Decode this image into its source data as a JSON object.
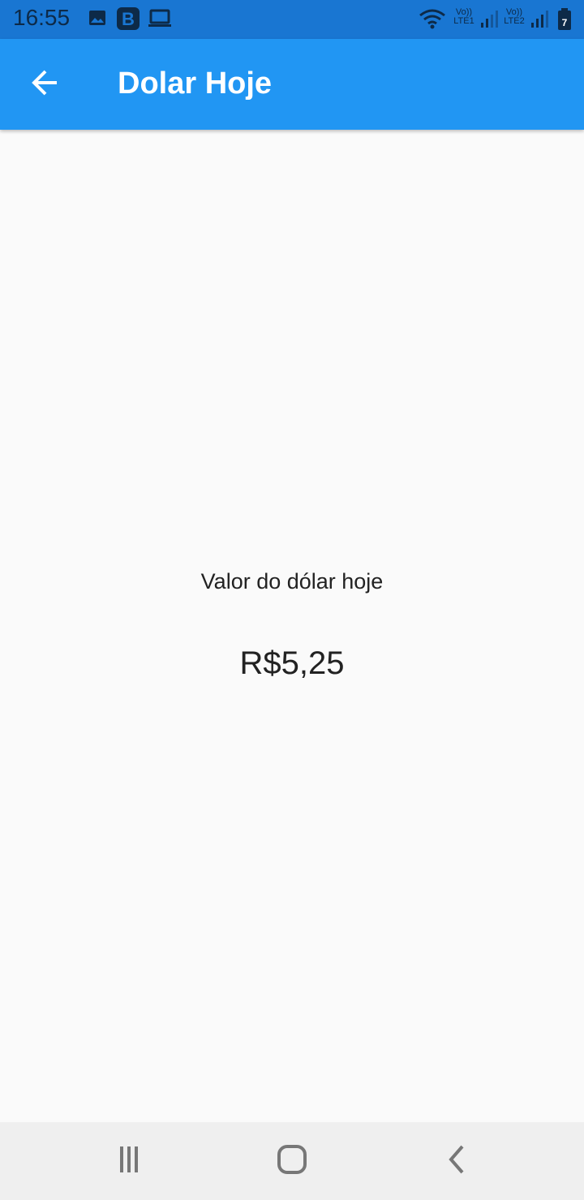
{
  "status_bar": {
    "time": "16:55",
    "lte1_label": "Vo))\nLTE1",
    "lte2_label": "Vo))\nLTE2",
    "battery_level": "7",
    "icons": [
      "image-icon",
      "b-app-icon",
      "laptop-icon",
      "wifi-icon",
      "signal-icon",
      "battery-icon"
    ]
  },
  "app_bar": {
    "title": "Dolar Hoje",
    "back_icon": "arrow-back-icon",
    "background": "#2196f3"
  },
  "main": {
    "label": "Valor do dólar hoje",
    "value": "R$5,25"
  },
  "nav_bar": {
    "icons": [
      "recent-apps-icon",
      "home-icon",
      "back-nav-icon"
    ]
  }
}
